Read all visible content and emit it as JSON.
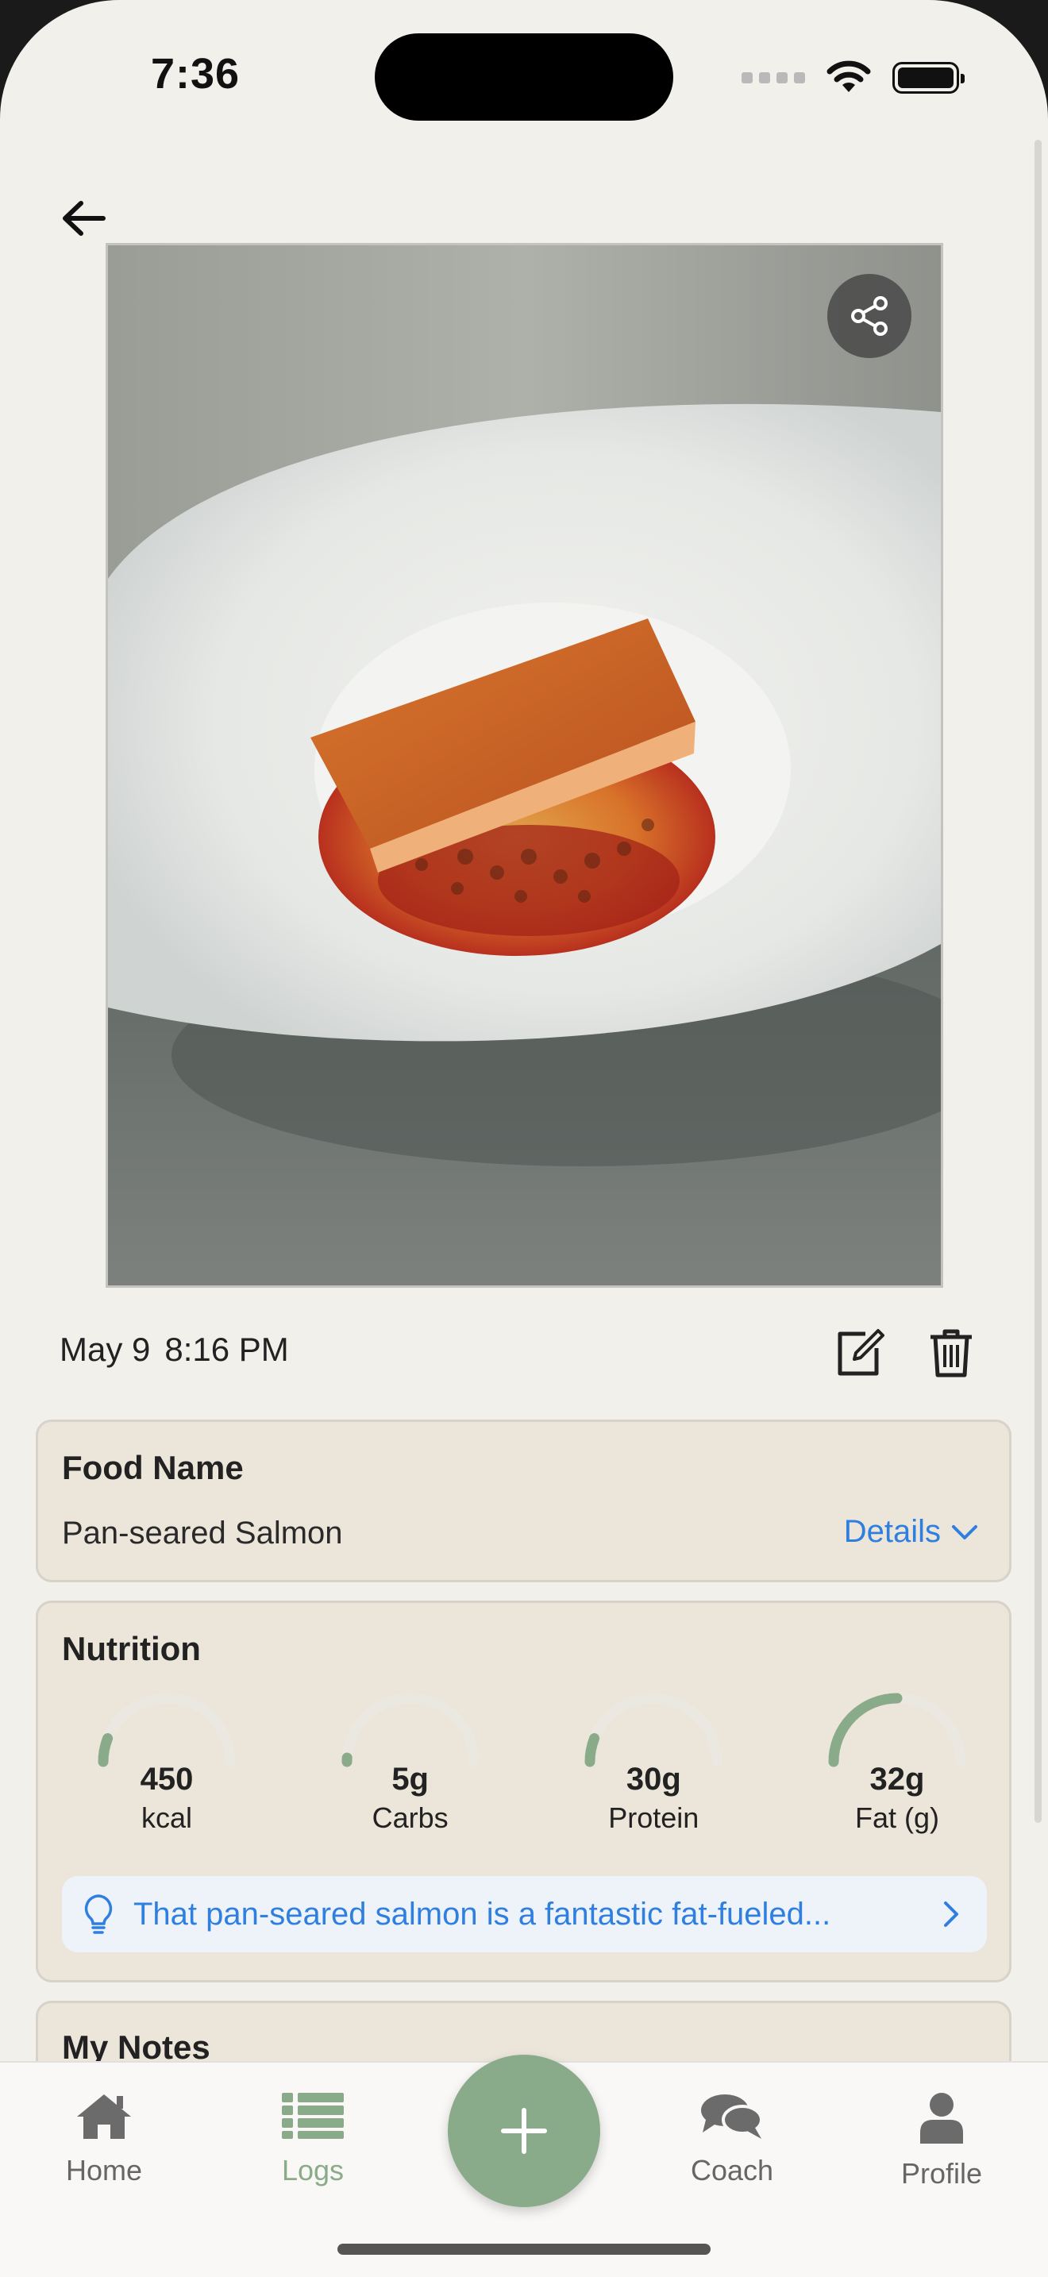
{
  "status_bar": {
    "time": "7:36"
  },
  "entry": {
    "date": "May 9",
    "time": "8:16 PM"
  },
  "food_card": {
    "title": "Food Name",
    "food_name": "Pan-seared Salmon",
    "details_label": "Details"
  },
  "nutrition": {
    "title": "Nutrition",
    "items": [
      {
        "value": "450",
        "unit": "kcal",
        "fraction": 0.12
      },
      {
        "value": "5g",
        "unit": "Carbs",
        "fraction": 0.02
      },
      {
        "value": "30g",
        "unit": "Protein",
        "fraction": 0.12
      },
      {
        "value": "32g",
        "unit": "Fat (g)",
        "fraction": 0.5
      }
    ],
    "tip": "That pan-seared salmon is a fantastic fat-fueled..."
  },
  "notes_card": {
    "title": "My Notes"
  },
  "tabbar": {
    "items": [
      {
        "label": "Home",
        "icon": "home-icon"
      },
      {
        "label": "Logs",
        "icon": "list-icon"
      },
      {
        "label": "Coach",
        "icon": "chat-icon"
      },
      {
        "label": "Profile",
        "icon": "profile-icon"
      }
    ],
    "add_icon": "plus-icon"
  },
  "colors": {
    "background": "#f2f0eb",
    "card": "#ece5da",
    "accent": "#8aab89",
    "link": "#2f7fe0",
    "gauge_track": "#ebe8e2"
  }
}
